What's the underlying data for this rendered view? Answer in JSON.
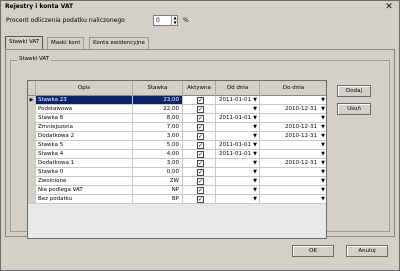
{
  "window": {
    "title": "Rejestry i konta VAT",
    "close_glyph": "✕"
  },
  "percent_field": {
    "label": "Procent odliczenia podatku naliczonego",
    "value": "0",
    "suffix": "%",
    "spin_up": "▲",
    "spin_down": "▼"
  },
  "tabs": [
    {
      "label": "Stawki VAT"
    },
    {
      "label": "Maski kont"
    },
    {
      "label": "Konta ewidencyjne"
    }
  ],
  "group_title": "Stawki VAT",
  "grid": {
    "columns": [
      "Opis",
      "Stawka",
      "Aktywna",
      "Od dnia",
      "Do dnia"
    ],
    "rows": [
      {
        "indicator": "▶",
        "desc": "Stawka 23",
        "rate": "23,00",
        "from": "2011-01-01",
        "to": "",
        "selected": true
      },
      {
        "indicator": "",
        "desc": "Podstawowa",
        "rate": "22,00",
        "from": "",
        "to": "2010-12-31"
      },
      {
        "indicator": "",
        "desc": "Stawka 8",
        "rate": "8,00",
        "from": "2011-01-01",
        "to": ""
      },
      {
        "indicator": "",
        "desc": "Zmniejszona",
        "rate": "7,00",
        "from": "",
        "to": "2010-12-31"
      },
      {
        "indicator": "",
        "desc": "Dodatkowa 2",
        "rate": "3,00",
        "from": "",
        "to": "2010-12-31"
      },
      {
        "indicator": "",
        "desc": "Stawka 5",
        "rate": "5,00",
        "from": "2011-01-01",
        "to": ""
      },
      {
        "indicator": "",
        "desc": "Stawka 4",
        "rate": "4,00",
        "from": "2011-01-01",
        "to": ""
      },
      {
        "indicator": "",
        "desc": "Dodatkowa 1",
        "rate": "3,00",
        "from": "",
        "to": "2010-12-31"
      },
      {
        "indicator": "",
        "desc": "Stawka 0",
        "rate": "0,00",
        "from": "",
        "to": ""
      },
      {
        "indicator": "",
        "desc": "Zwolnione",
        "rate": "ZW",
        "from": "",
        "to": ""
      },
      {
        "indicator": "",
        "desc": "Nie podlega VAT",
        "rate": "NP",
        "from": "",
        "to": ""
      },
      {
        "indicator": "",
        "desc": "Bez podatku",
        "rate": "BP",
        "from": "",
        "to": ""
      }
    ],
    "check_glyph": "✓",
    "dropdown_glyph": "▼"
  },
  "side_buttons": {
    "add": "Dodaj",
    "remove": "Usuń"
  },
  "footer_buttons": {
    "ok": "OK",
    "cancel": "Anuluj"
  }
}
